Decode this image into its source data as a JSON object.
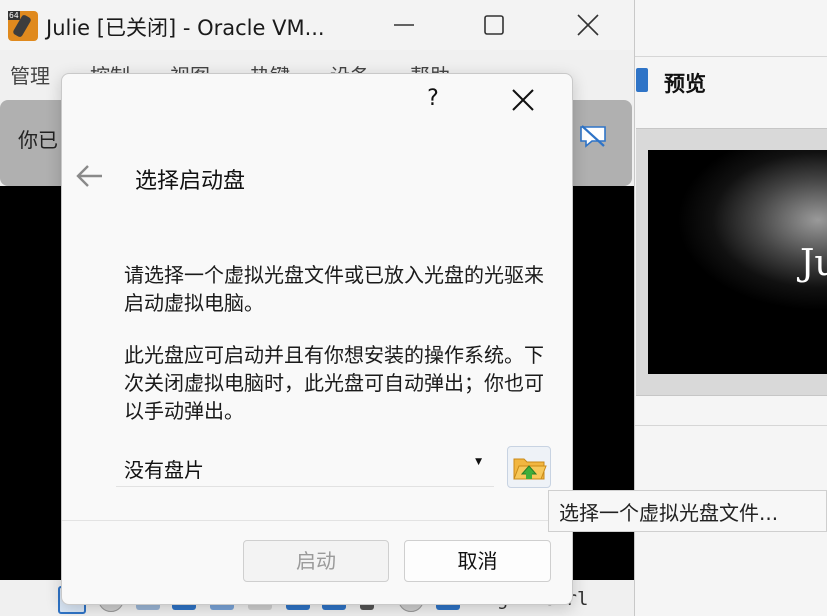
{
  "vm_window": {
    "title": "Julie [已关闭] - Oracle VM...",
    "app_icon_badge": "64",
    "menu": [
      "管理",
      "控制",
      "视图",
      "热键",
      "设备",
      "帮助"
    ],
    "notification_text": "你已",
    "status_host_key": "Right Ctrl"
  },
  "manager": {
    "preview_label": "预览",
    "preview_screen_text": "Ju"
  },
  "dialog": {
    "help_label": "?",
    "title": "选择启动盘",
    "paragraph1": "请选择一个虚拟光盘文件或已放入光盘的光驱来启动虚拟电脑。",
    "paragraph2": "此光盘应可启动并且有你想安装的操作系统。下次关闭虚拟电脑时，此光盘可自动弹出；你也可以手动弹出。",
    "disk_select_value": "没有盘片",
    "start_button": "启动",
    "cancel_button": "取消"
  },
  "tooltip": {
    "text": "选择一个虚拟光盘文件..."
  },
  "colors": {
    "vm_screen": "#000000",
    "notification_bar": "#b0b0b0",
    "app_icon": "#e08a1e",
    "accent_blue": "#2f74c7"
  }
}
